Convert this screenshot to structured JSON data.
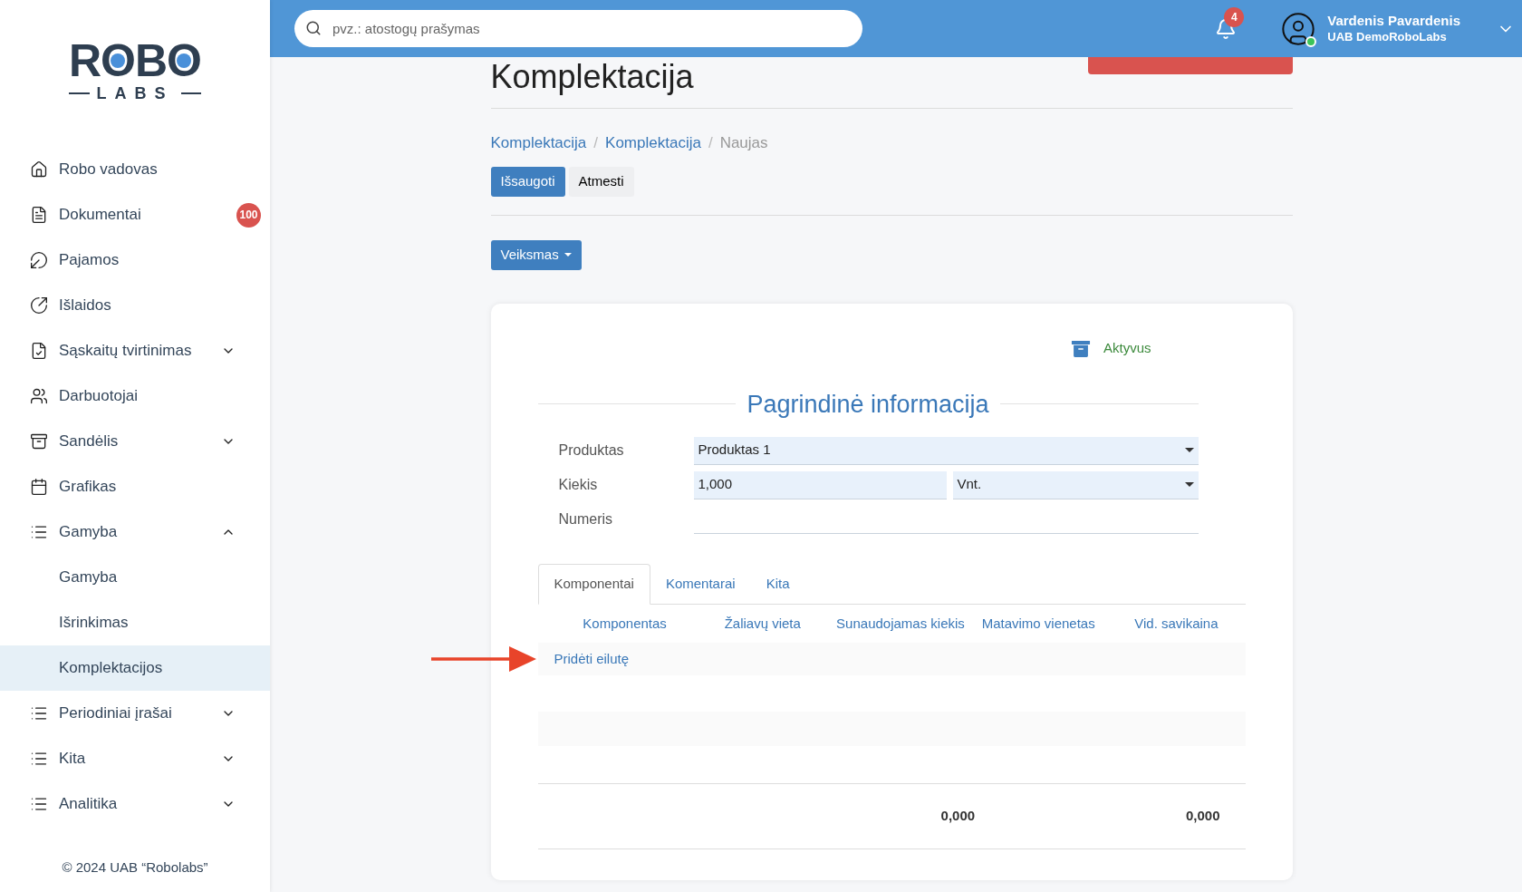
{
  "header": {
    "search": {
      "placeholder": "pvz.: atostogų prašymas"
    },
    "notifications": {
      "count": "4"
    },
    "user": {
      "name": "Vardenis Pavardenis",
      "company": "UAB DemoRoboLabs",
      "online": true
    }
  },
  "sidebar": {
    "logo": {
      "letters": [
        {
          "char": "R",
          "dot": false
        },
        {
          "char": "O",
          "dot": true
        },
        {
          "char": "B",
          "dot": false
        },
        {
          "char": "O",
          "dot": true
        }
      ],
      "sub": "LABS"
    },
    "items": [
      {
        "label": "Robo vadovas",
        "selected": false
      },
      {
        "label": "Dokumentai",
        "selected": false,
        "badge": "100"
      },
      {
        "label": "Pajamos",
        "selected": false
      },
      {
        "label": "Išlaidos",
        "selected": false
      },
      {
        "label": "Sąskaitų tvirtinimas",
        "selected": false,
        "expanded": false
      },
      {
        "label": "Darbuotojai",
        "selected": false
      },
      {
        "label": "Sandėlis",
        "selected": false,
        "expanded": false
      },
      {
        "label": "Grafikas",
        "selected": false
      },
      {
        "label": "Gamyba",
        "selected": false,
        "expanded": true,
        "children": [
          {
            "label": "Gamyba",
            "selected": false
          },
          {
            "label": "Išrinkimas",
            "selected": false
          },
          {
            "label": "Komplektacijos",
            "selected": true
          }
        ]
      },
      {
        "label": "Periodiniai įrašai",
        "selected": false,
        "expanded": false
      },
      {
        "label": "Kita",
        "selected": false,
        "expanded": false
      },
      {
        "label": "Analitika",
        "selected": false,
        "expanded": false
      }
    ],
    "footer": "© 2024 UAB “Robolabs”"
  },
  "page": {
    "title": "Komplektacija",
    "breadcrumb": [
      "Komplektacija",
      "Komplektacija",
      "Naujas"
    ],
    "breadcrumb_separator": "/",
    "save": "Išsaugoti",
    "discard": "Atmesti",
    "action": "Veiksmas"
  },
  "card": {
    "status": "Aktyvus",
    "section": "Pagrindinė informacija",
    "fields": [
      {
        "label": "Produktas",
        "kind": "select",
        "value": "Produktas 1"
      },
      {
        "label": "Kiekis",
        "kind": "quantity",
        "value": "1,000",
        "unit": "Vnt."
      },
      {
        "label": "Numeris",
        "kind": "text"
      }
    ],
    "tabs": [
      {
        "label": "Komponentai",
        "selected": true
      },
      {
        "label": "Komentarai",
        "selected": false
      },
      {
        "label": "Kita",
        "selected": false
      }
    ],
    "table": {
      "columns": [
        "Komponentas",
        "Žaliavų vieta",
        "Sunaudojamas kiekis",
        "Matavimo vienetas",
        "Vid. savikaina"
      ],
      "add_row": "Pridėti eilutę",
      "totals": {
        "quantity": "0,000",
        "cost": "0,000"
      }
    }
  }
}
